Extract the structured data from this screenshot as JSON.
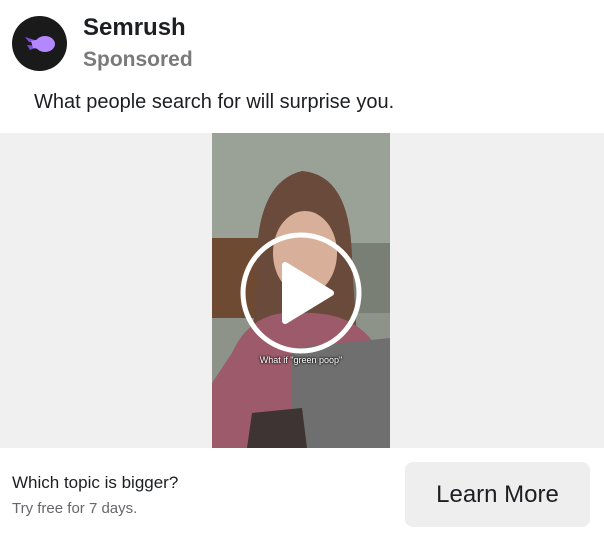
{
  "advertiser": {
    "name": "Semrush",
    "label": "Sponsored",
    "logo_icon": "semrush-comet-icon",
    "logo_color": "#b388ff"
  },
  "post": {
    "text": "What people search for will surprise you."
  },
  "video": {
    "caption": "What if \"green poop\"",
    "play_icon": "play-icon"
  },
  "cta": {
    "headline": "Which topic is bigger?",
    "subtext": "Try free for 7 days.",
    "button_label": "Learn More"
  }
}
